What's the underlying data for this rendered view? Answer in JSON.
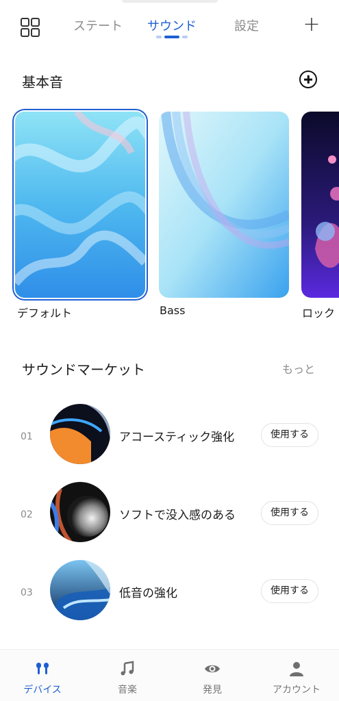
{
  "top_tabs": [
    {
      "label": "ステート",
      "active": false
    },
    {
      "label": "サウンド",
      "active": true
    },
    {
      "label": "設定",
      "active": false
    }
  ],
  "base_sound": {
    "title": "基本音",
    "cards": [
      {
        "label": "デフォルト",
        "selected": true
      },
      {
        "label": "Bass",
        "selected": false
      },
      {
        "label": "ロック",
        "selected": false
      }
    ]
  },
  "market": {
    "title": "サウンドマーケット",
    "more": "もっと",
    "items": [
      {
        "num": "01",
        "name": "アコースティック強化",
        "action": "使用する"
      },
      {
        "num": "02",
        "name": "ソフトで没入感のある",
        "action": "使用する"
      },
      {
        "num": "03",
        "name": "低音の強化",
        "action": "使用する"
      }
    ]
  },
  "bottom_nav": [
    {
      "label": "デバイス",
      "icon": "earbuds-icon",
      "active": true
    },
    {
      "label": "音楽",
      "icon": "music-note-icon",
      "active": false
    },
    {
      "label": "発見",
      "icon": "eye-icon",
      "active": false
    },
    {
      "label": "アカウント",
      "icon": "person-icon",
      "active": false
    }
  ],
  "colors": {
    "accent": "#1d5fd1",
    "muted": "#8a8a8a"
  }
}
